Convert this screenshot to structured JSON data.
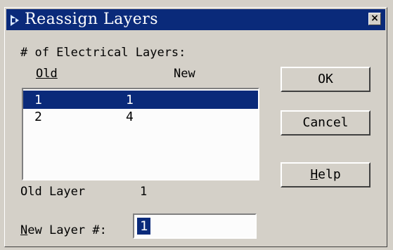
{
  "window": {
    "title": "Reassign Layers",
    "close_label": "×"
  },
  "layers": {
    "heading": "# of Electrical Layers:",
    "col_old": "Old",
    "col_new": "New",
    "rows": [
      {
        "old": "1",
        "new": "1",
        "selected": true
      },
      {
        "old": "2",
        "new": "4",
        "selected": false
      }
    ]
  },
  "old_layer": {
    "label": "Old Layer",
    "value": "1"
  },
  "new_layer": {
    "label_mnemonic": "N",
    "label_rest": "ew Layer #:",
    "value": "1"
  },
  "buttons": {
    "ok": "OK",
    "cancel": "Cancel",
    "help_mnemonic": "H",
    "help_rest": "elp"
  }
}
